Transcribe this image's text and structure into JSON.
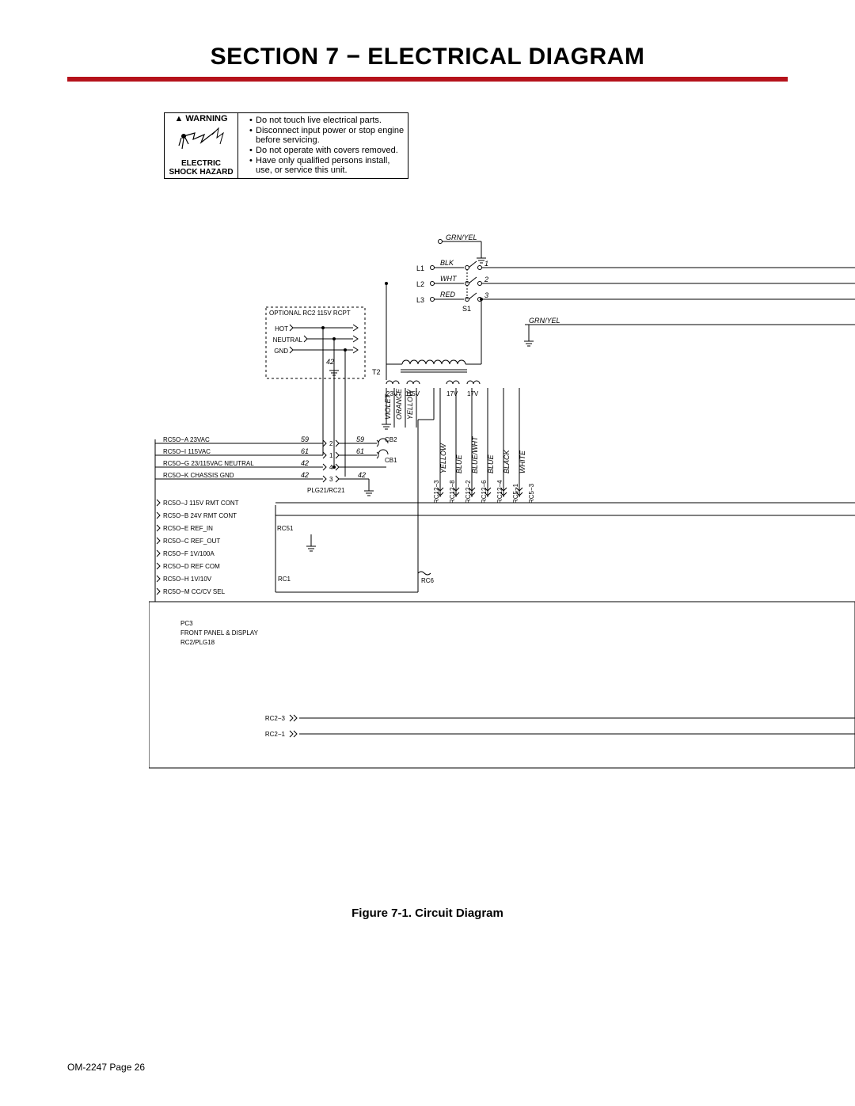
{
  "section_title": "SECTION 7 − ELECTRICAL DIAGRAM",
  "warning": {
    "heading": "WARNING",
    "sub1": "ELECTRIC",
    "sub2": "SHOCK HAZARD",
    "bullets": [
      "Do not touch live electrical parts.",
      "Disconnect input power or stop engine before servicing.",
      "Do not operate with covers removed.",
      "Have only qualified persons install, use, or service this unit."
    ]
  },
  "diagram": {
    "input_lines": {
      "L1": "L1",
      "L2": "L2",
      "L3": "L3",
      "gnd_top": "GRN/YEL",
      "blk": "BLK",
      "wht": "WHT",
      "red": "RED",
      "n1": "1",
      "n2": "2",
      "n3": "3",
      "s1": "S1",
      "gnd_right": "GRN/YEL"
    },
    "optional_box": {
      "title": "OPTIONAL RC2 115V RCPT",
      "rows": [
        "HOT",
        "NEUTRAL",
        "GND"
      ],
      "num": "42"
    },
    "transformer": {
      "label": "T2",
      "taps": [
        "23V",
        "115V",
        "17V",
        "17V"
      ],
      "colors": [
        "VIOLET",
        "ORANGE",
        "YELLOW"
      ]
    },
    "cb": {
      "cb1": "CB1",
      "cb2": "CB2"
    },
    "plg_left": {
      "rows": [
        {
          "name": "RC5O−A 23VAC",
          "num": "59",
          "term": "2",
          "rnum": "59"
        },
        {
          "name": "RC5O−I 115VAC",
          "num": "61",
          "term": "1",
          "rnum": "61"
        },
        {
          "name": "RC5O−G 23/115VAC NEUTRAL",
          "num": "42",
          "term": "4",
          "rnum": ""
        },
        {
          "name": "RC5O−K CHASSIS GND",
          "num": "42",
          "term": "3",
          "rnum": "42"
        }
      ],
      "below": [
        "RC5O−J 115V RMT CONT",
        "RC5O−B 24V RMT CONT",
        "RC5O−E REF_IN",
        "RC5O−C REF_OUT",
        "RC5O−F 1V/100A",
        "RC5O−D REF COM",
        "RC5O−H 1V/10V",
        "RC5O−M CC/CV SEL"
      ],
      "plg": "PLG21/RC21",
      "rc51": "RC51",
      "rc1": "RC1",
      "rc6": "RC6"
    },
    "rc12": {
      "pins": [
        "RC12−3",
        "RC12−8",
        "RC12−2",
        "RC12−6",
        "RC12−4",
        "RC5−1",
        "RC5−3"
      ],
      "colors": [
        "YELLOW",
        "BLUE",
        "BLUE/WHT",
        "BLUE",
        "BLACK",
        "WHITE",
        ""
      ]
    },
    "pc3": {
      "l1": "PC3",
      "l2": "FRONT PANEL & DISPLAY",
      "l3": "RC2/PLG18"
    },
    "rc2": {
      "a": "RC2−3",
      "b": "RC2−1"
    }
  },
  "fig_caption": "Figure 7-1. Circuit Diagram",
  "footer": "OM-2247 Page 26"
}
